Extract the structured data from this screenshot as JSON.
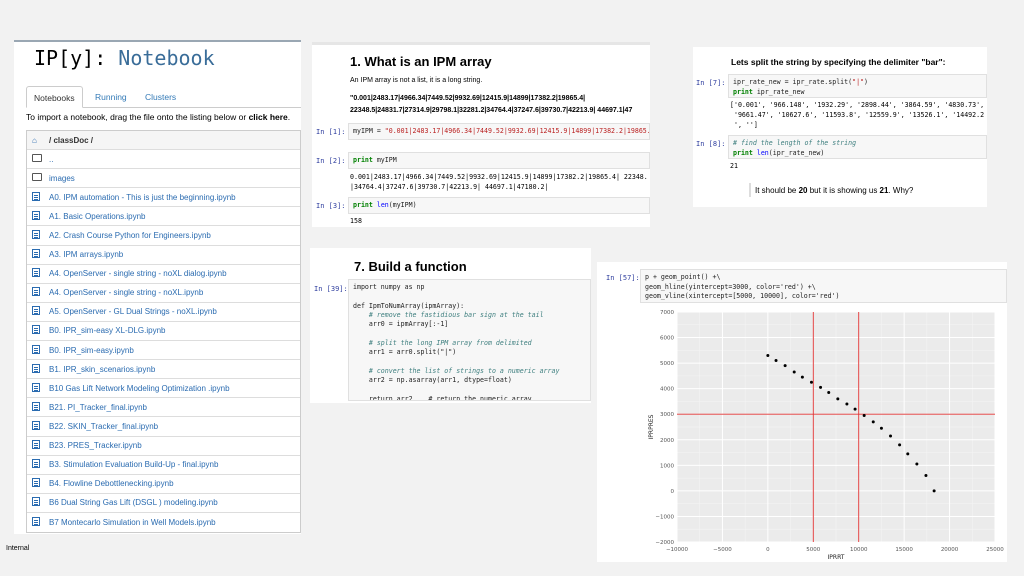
{
  "tree": {
    "logo_ip": "IP[y]:",
    "logo_nb": "Notebook",
    "tabs": [
      "Notebooks",
      "Running",
      "Clusters"
    ],
    "hint_pre": "To import a notebook, drag the file onto the listing below or ",
    "hint_bold": "click here",
    "hint_post": ".",
    "breadcrumb": "/ classDoc /",
    "folders": [
      "..",
      "images"
    ],
    "files": [
      "A0. IPM automation - This is just the beginning.ipynb",
      "A1. Basic Operations.ipynb",
      "A2. Crash Course Python for Engineers.ipynb",
      "A3. IPM arrays.ipynb",
      "A4. OpenServer - single string - noXL dialog.ipynb",
      "A4. OpenServer - single string - noXL.ipynb",
      "A5. OpenServer - GL Dual Strings - noXL.ipynb",
      "B0. IPR_sim-easy XL-DLG.ipynb",
      "B0. IPR_sim-easy.ipynb",
      "B1. IPR_skin_scenarios.ipynb",
      "B10 Gas Lift Network Modeling Optimization .ipynb",
      "B21. PI_Tracker_final.ipynb",
      "B22. SKIN_Tracker_final.ipynb",
      "B23. PRES_Tracker.ipynb",
      "B3. Stimulation Evaluation Build-Up - final.ipynb",
      "B4. Flowline Debottlenecking.ipynb",
      "B6 Dual String Gas Lift (DSGL ) modeling.ipynb",
      "B7 Montecarlo Simulation in Well Models.ipynb"
    ]
  },
  "panel1": {
    "title": "1. What is an IPM array",
    "desc": "An IPM array is not a list, it is a long string.",
    "bold_line1": "\"0.001|2483.17|4966.34|7449.52|9932.69|12415.9|14899|17382.2|19865.4|",
    "bold_line2": "22348.5|24831.7|27314.9|29798.1|32281.2|34764.4|37247.6|39730.7|42213.9| 44697.1|47",
    "in1": "In [1]:",
    "code1_var": "myIPM = ",
    "code1_str": "\"0.001|2483.17|4966.34|7449.52|9932.69|12415.9|14899|17382.2|19865.",
    "in2": "In [2]:",
    "code2": "print myIPM",
    "out2_line1": "0.001|2483.17|4966.34|7449.52|9932.69|12415.9|14899|17382.2|19865.4| 22348.",
    "out2_line2": "|34764.4|37247.6|39730.7|42213.9| 44697.1|47180.2|",
    "in3": "In [3]:",
    "code3": "print len(myIPM)",
    "out3": "158"
  },
  "panel2": {
    "title": "7. Build a function",
    "in": "In [39]:",
    "lines": [
      "import numpy as np",
      "",
      "def IpmToNumArray(ipmArray):",
      "    # remove the fastidious bar sign at the tail",
      "    arr0 = ipmArray[:-1]",
      "",
      "    # split the long IPM array from delimited",
      "    arr1 = arr0.split(\"|\")",
      "",
      "    # convert the list of strings to a numeric array",
      "    arr2 = np.asarray(arr1, dtype=float)",
      "",
      "    return arr2    # return the numeric array"
    ]
  },
  "panel3": {
    "title": "Lets split the string by specifying the delimiter \"bar\":",
    "in7": "In [7]:",
    "code7_l1": "ipr_rate_new = ipr_rate.split(\"|\")",
    "code7_l2": "print ipr_rate_new",
    "out7_l1": "['0.001', '966.148', '1932.29', '2898.44', '3864.59', '4830.73',",
    "out7_l2": " '9661.47', '10627.6', '11593.8', '12559.9', '13526.1', '14492.2",
    "out7_l3": " ', '']",
    "in8": "In [8]:",
    "code8_l1": "# find the length of the string",
    "code8_l2": "print len(ipr_rate_new)",
    "out8": "21",
    "note_pre": "It should be ",
    "note_b1": "20",
    "note_mid": " but it is showing us ",
    "note_b2": "21",
    "note_post": ". Why?"
  },
  "panel4": {
    "in": "In [57]:",
    "code_l1": "p + geom_point() +\\",
    "code_l2": "geom_hline(yintercept=3000, color='red') +\\",
    "code_l3": "geom_vline(xintercept=[5000, 10000], color='red')"
  },
  "chart_data": {
    "type": "scatter",
    "xlabel": "IPRRT",
    "ylabel": "IPRPRES",
    "xlim": [
      -10000,
      25000
    ],
    "ylim": [
      -2000,
      7000
    ],
    "xticks": [
      -10000,
      -5000,
      0,
      5000,
      10000,
      15000,
      20000,
      25000
    ],
    "xtick_labels": [
      "−10000",
      "−5000",
      "0",
      "5000",
      "10000",
      "15000",
      "20000",
      "25000"
    ],
    "yticks": [
      -2000,
      -1000,
      0,
      1000,
      2000,
      3000,
      4000,
      5000,
      6000,
      7000
    ],
    "ytick_labels": [
      "−2000",
      "−1000",
      "0",
      "1000",
      "2000",
      "3000",
      "4000",
      "5000",
      "6000",
      "7000"
    ],
    "hline": 3000,
    "vlines": [
      5000,
      10000
    ],
    "line_color": "#e03030",
    "point_color": "#000000",
    "grid": true,
    "points": [
      [
        0,
        5300
      ],
      [
        900,
        5100
      ],
      [
        1900,
        4900
      ],
      [
        2900,
        4650
      ],
      [
        3800,
        4450
      ],
      [
        4800,
        4250
      ],
      [
        5800,
        4050
      ],
      [
        6700,
        3850
      ],
      [
        7700,
        3600
      ],
      [
        8700,
        3400
      ],
      [
        9600,
        3200
      ],
      [
        10600,
        2950
      ],
      [
        11600,
        2700
      ],
      [
        12500,
        2450
      ],
      [
        13500,
        2150
      ],
      [
        14500,
        1800
      ],
      [
        15400,
        1450
      ],
      [
        16400,
        1050
      ],
      [
        17400,
        600
      ],
      [
        18300,
        0
      ]
    ]
  },
  "footer": "Internal"
}
